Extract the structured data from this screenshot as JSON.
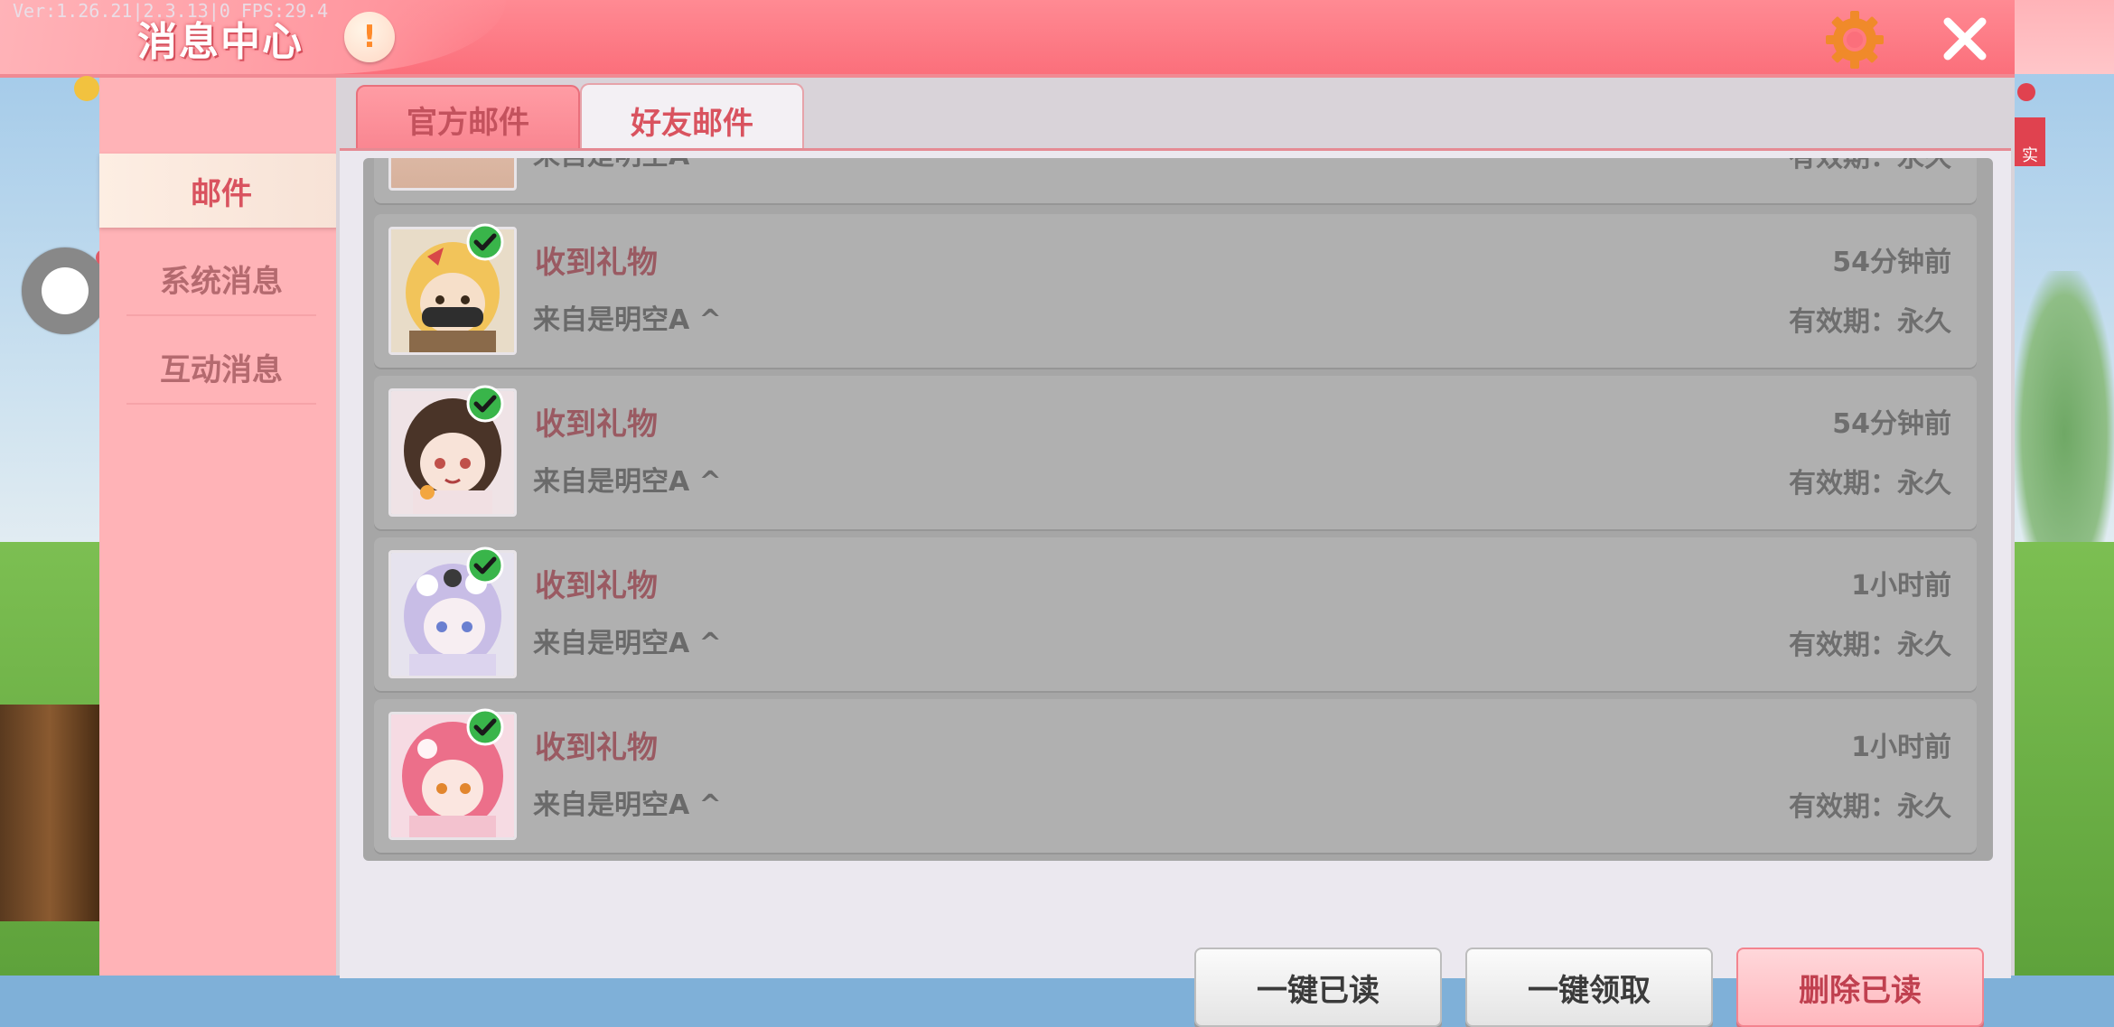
{
  "header": {
    "title": "消息中心",
    "debug": "Ver:1.26.21|2.3.13|0 FPS:29.4"
  },
  "sidebar": {
    "items": [
      {
        "label": "邮件",
        "selected": true
      },
      {
        "label": "系统消息",
        "selected": false
      },
      {
        "label": "互动消息",
        "selected": false
      }
    ]
  },
  "tabs": [
    {
      "label": "官方邮件",
      "selected": false
    },
    {
      "label": "好友邮件",
      "selected": true
    }
  ],
  "mail_list": [
    {
      "title": "",
      "from": "来自是明空A ^",
      "time": "",
      "validity": "有效期：永久",
      "claimed": true,
      "partial": true,
      "avatar": "avatar-bandit"
    },
    {
      "title": "收到礼物",
      "from": "来自是明空A ^",
      "time": "54分钟前",
      "validity": "有效期：永久",
      "claimed": true,
      "avatar": "avatar-blonde-masked"
    },
    {
      "title": "收到礼物",
      "from": "来自是明空A ^",
      "time": "54分钟前",
      "validity": "有效期：永久",
      "claimed": true,
      "avatar": "avatar-brunette"
    },
    {
      "title": "收到礼物",
      "from": "来自是明空A ^",
      "time": "1小时前",
      "validity": "有效期：永久",
      "claimed": true,
      "avatar": "avatar-lavender"
    },
    {
      "title": "收到礼物",
      "from": "来自是明空A ^",
      "time": "1小时前",
      "validity": "有效期：永久",
      "claimed": true,
      "avatar": "avatar-pink"
    }
  ],
  "actions": {
    "mark_all_read": "一键已读",
    "claim_all": "一键领取",
    "delete_read": "删除已读"
  },
  "side_badge": "实",
  "colors": {
    "header": "#fb6f7b",
    "sidebar": "#ffb3b7",
    "accent": "#d9535f",
    "list_bg": "#a6a6a6",
    "check": "#39b54a"
  }
}
